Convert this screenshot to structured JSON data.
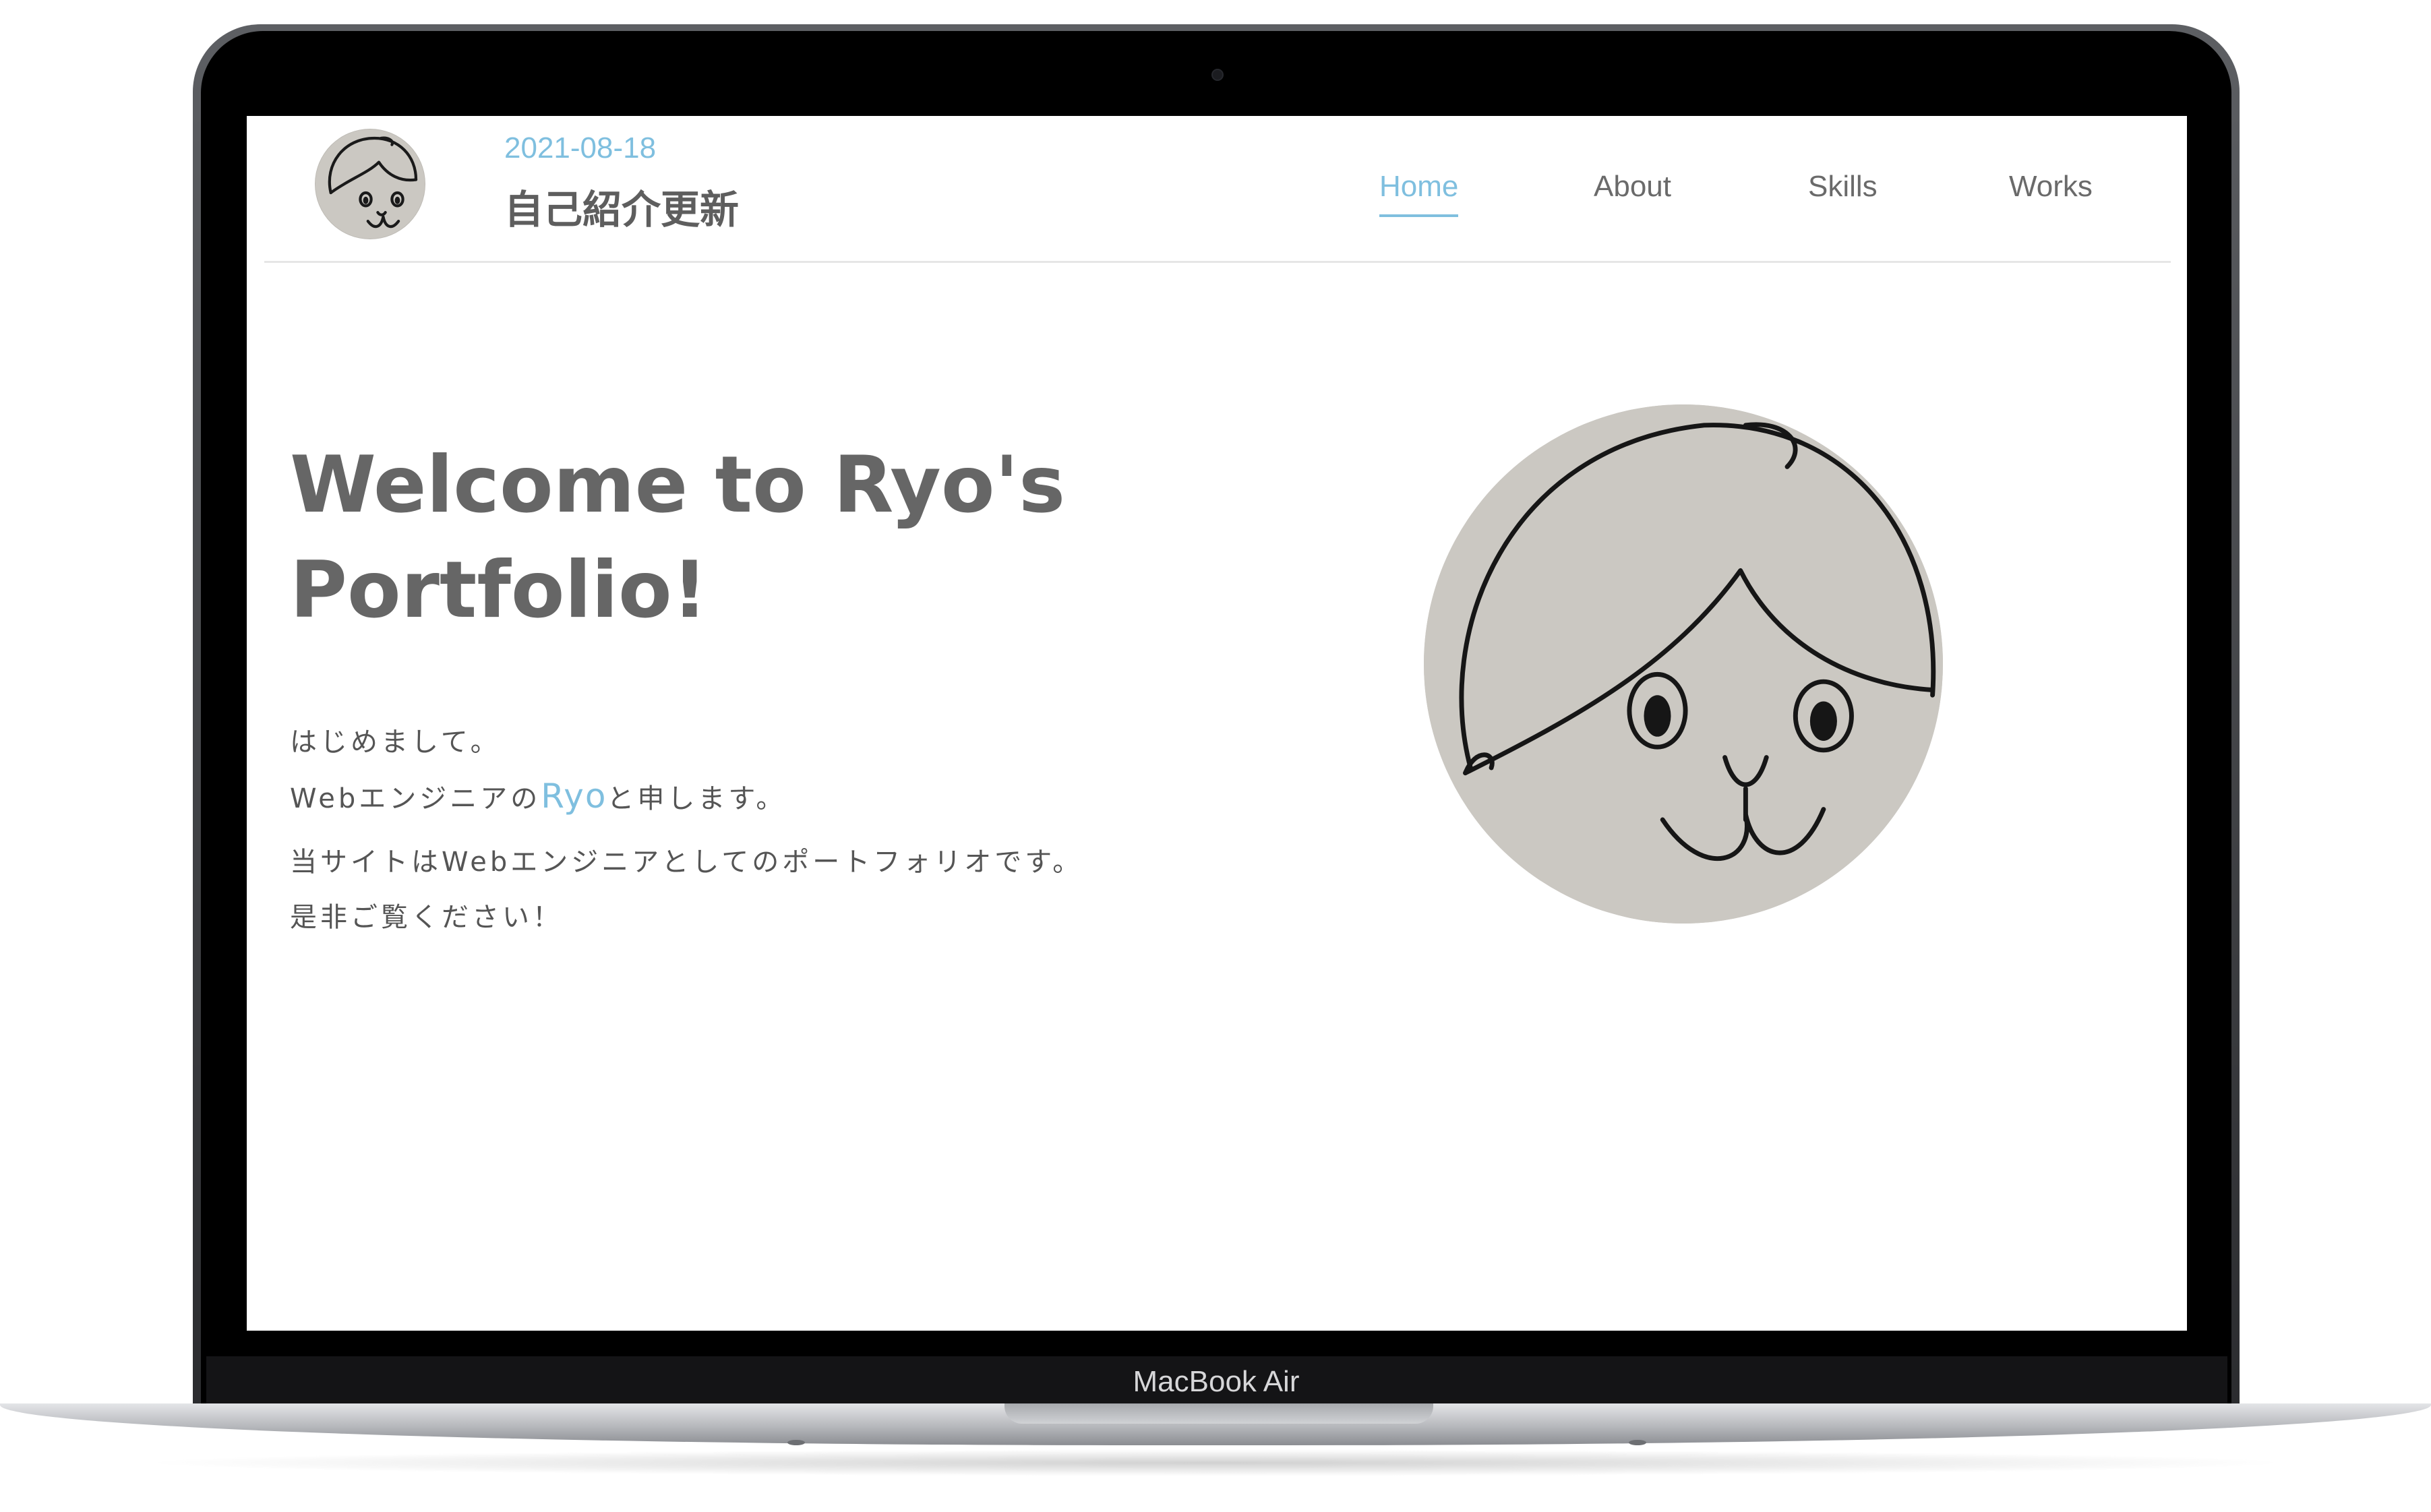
{
  "device": {
    "label": "MacBook Air"
  },
  "site": {
    "header": {
      "date": "2021-08-18",
      "title": "自己紹介更新"
    },
    "nav": [
      {
        "label": "Home",
        "active": true
      },
      {
        "label": "About",
        "active": false
      },
      {
        "label": "Skills",
        "active": false
      },
      {
        "label": "Works",
        "active": false
      }
    ],
    "hero": {
      "title_line1": "Welcome to Ryo's",
      "title_line2": "Portfolio!"
    },
    "intro": {
      "line1": "はじめまして。",
      "line2_prefix": "Webエンジニアの",
      "line2_name": "Ryo",
      "line2_suffix": "と申します。",
      "line3": "当サイトはWebエンジニアとしてのポートフォリオです。",
      "line4": "是非ご覧ください！"
    }
  },
  "colors": {
    "accent": "#7fbfdf",
    "heading": "#666666",
    "text": "#555555",
    "avatar_bg": "#cbc8c2"
  },
  "icons": {
    "logo": "cat-face-avatar-icon",
    "portrait": "cat-face-portrait-image"
  }
}
